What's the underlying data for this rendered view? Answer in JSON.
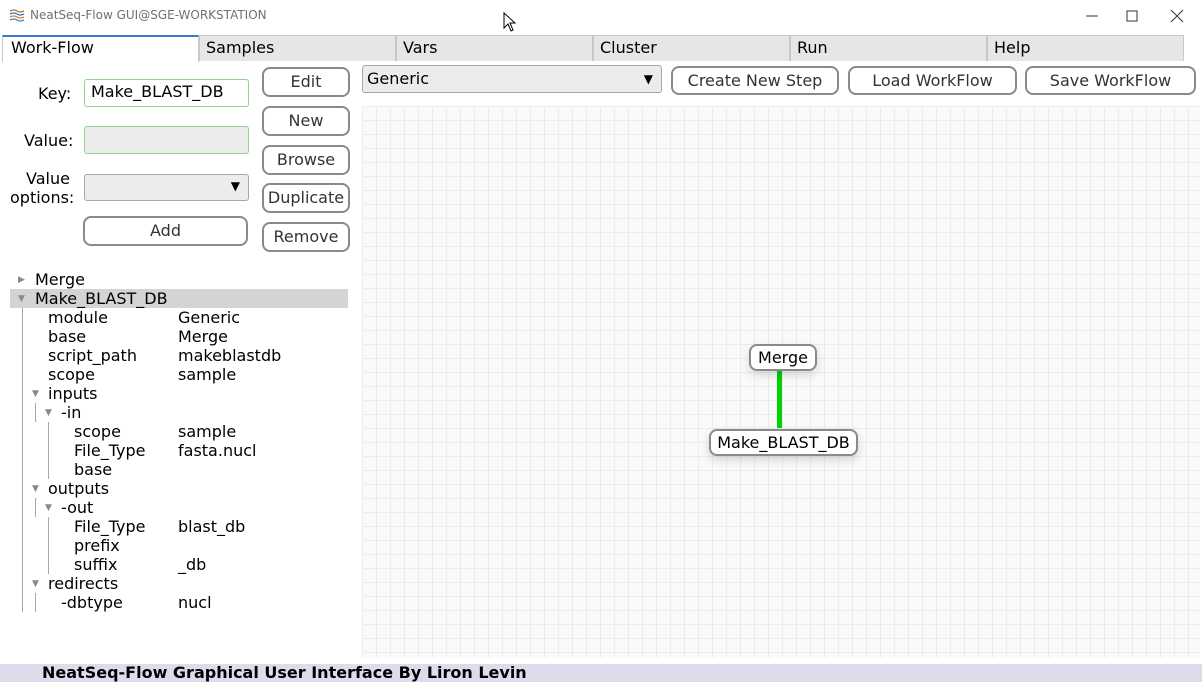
{
  "window": {
    "title": "NeatSeq-Flow GUI@SGE-WORKSTATION",
    "icons": [
      "app-icon",
      "minimize-icon",
      "maximize-icon",
      "close-icon",
      "mouse-cursor-icon"
    ]
  },
  "tabs": [
    "Work-Flow",
    "Samples",
    "Vars",
    "Cluster",
    "Run",
    "Help"
  ],
  "editor": {
    "key_label": "Key:",
    "key_value": "Make_BLAST_DB",
    "value_label": "Value:",
    "value_value": "",
    "options_label_line1": "Value",
    "options_label_line2": "options:",
    "options_selected": "",
    "add_button": "Add",
    "edit_button": "Edit",
    "new_button": "New",
    "browse_button": "Browse",
    "duplicate_button": "Duplicate",
    "remove_button": "Remove"
  },
  "tree": [
    {
      "key": "Merge",
      "value": "",
      "caret": "▶",
      "selected": false
    },
    {
      "key": "Make_BLAST_DB",
      "value": "",
      "caret": "▼",
      "selected": true
    },
    {
      "key": "module",
      "value": "Generic"
    },
    {
      "key": "base",
      "value": "Merge"
    },
    {
      "key": "script_path",
      "value": "makeblastdb"
    },
    {
      "key": "scope",
      "value": "sample"
    },
    {
      "key": "inputs",
      "value": "",
      "caret": "▼"
    },
    {
      "key": "-in",
      "value": "",
      "caret": "▼"
    },
    {
      "key": "scope",
      "value": "sample"
    },
    {
      "key": "File_Type",
      "value": "fasta.nucl"
    },
    {
      "key": "base",
      "value": ""
    },
    {
      "key": "outputs",
      "value": "",
      "caret": "▼"
    },
    {
      "key": "-out",
      "value": "",
      "caret": "▼"
    },
    {
      "key": "File_Type",
      "value": "blast_db"
    },
    {
      "key": "prefix",
      "value": ""
    },
    {
      "key": "suffix",
      "value": "_db"
    },
    {
      "key": "redirects",
      "value": "",
      "caret": "▼"
    },
    {
      "key": "-dbtype",
      "value": "nucl"
    }
  ],
  "toolbar": {
    "module_select": "Generic",
    "create_step": "Create New Step",
    "load_workflow": "Load WorkFlow",
    "save_workflow": "Save WorkFlow"
  },
  "graph": {
    "nodes": [
      "Merge",
      "Make_BLAST_DB"
    ],
    "edge_color": "#00d400"
  },
  "status": {
    "text": "NeatSeq-Flow Graphical User Interface By Liron Levin"
  },
  "colors": {
    "active_tab_accent": "#3c78d8",
    "field_border": "#90d490",
    "selected_row": "#d4d4d4"
  }
}
